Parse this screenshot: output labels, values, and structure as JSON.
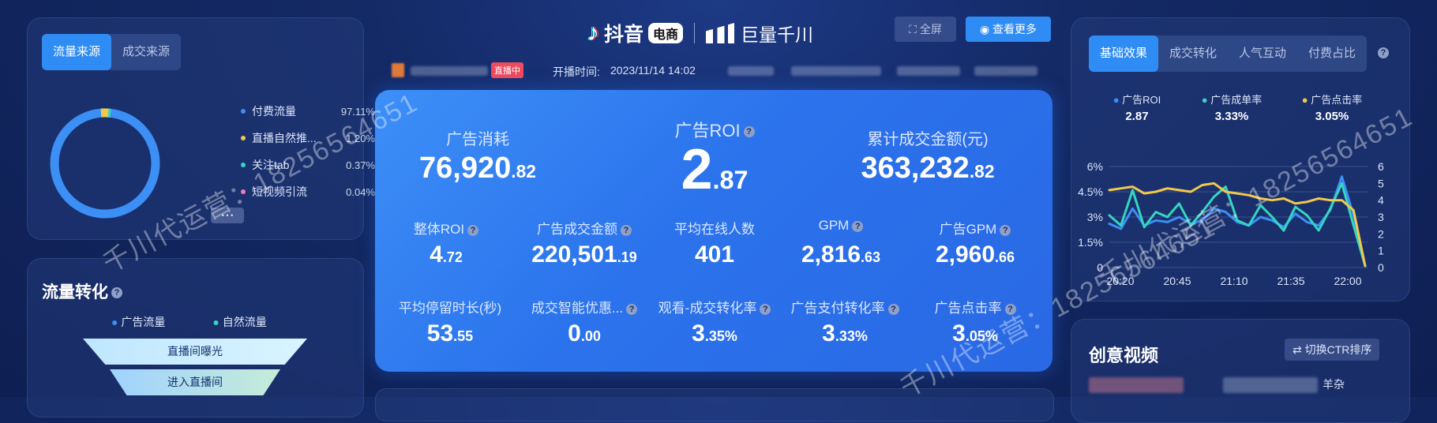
{
  "brand": {
    "douyin": "抖音",
    "ecommerce_badge": "电商",
    "qianchuan": "巨量千川"
  },
  "header": {
    "fullscreen_label": "全屏",
    "view_more_label": "查看更多",
    "live_badge": "直播中",
    "start_time_label": "开播时间:",
    "start_time": "2023/11/14 14:02"
  },
  "source": {
    "tabs": [
      "流量来源",
      "成交来源"
    ],
    "legend": [
      {
        "label": "付费流量",
        "pct": "97.11%",
        "color": "#3b8ff5"
      },
      {
        "label": "直播自然推...",
        "pct": "1.20%",
        "color": "#f2c94c"
      },
      {
        "label": "关注tab",
        "pct": "0.37%",
        "color": "#34d6c1"
      },
      {
        "label": "短视频引流",
        "pct": "0.04%",
        "color": "#f27fb0"
      }
    ],
    "more": "• • •"
  },
  "flow": {
    "title": "流量转化",
    "legend": [
      {
        "label": "广告流量",
        "color": "#3b8ff5"
      },
      {
        "label": "自然流量",
        "color": "#34d6c1"
      }
    ],
    "stages": [
      "直播间曝光",
      "进入直播间"
    ]
  },
  "metrics": {
    "top": [
      {
        "title": "广告消耗",
        "int": "76,920",
        "dec": ".82",
        "help": false
      },
      {
        "title": "广告ROI",
        "int": "2",
        "dec": ".87",
        "help": true
      },
      {
        "title": "累计成交金额(元)",
        "int": "363,232",
        "dec": ".82",
        "help": false
      }
    ],
    "row2": [
      {
        "title": "整体ROI",
        "int": "4",
        "dec": ".72"
      },
      {
        "title": "广告成交金额",
        "int": "220,501",
        "dec": ".19"
      },
      {
        "title": "平均在线人数",
        "int": "401",
        "dec": ""
      },
      {
        "title": "GPM",
        "int": "2,816",
        "dec": ".63"
      },
      {
        "title": "广告GPM",
        "int": "2,960",
        "dec": ".66"
      }
    ],
    "row3": [
      {
        "title": "平均停留时长(秒)",
        "int": "53",
        "dec": ".55"
      },
      {
        "title": "成交智能优惠...",
        "int": "0",
        "dec": ".00"
      },
      {
        "title": "观看-成交转化率",
        "int": "3",
        "dec": ".35%"
      },
      {
        "title": "广告支付转化率",
        "int": "3",
        "dec": ".33%"
      },
      {
        "title": "广告点击率",
        "int": "3",
        "dec": ".05%"
      }
    ]
  },
  "effect": {
    "tabs": [
      "基础效果",
      "成交转化",
      "人气互动",
      "付费占比"
    ],
    "legend": [
      {
        "label": "广告ROI",
        "value": "2.87",
        "color": "#3b8ff5"
      },
      {
        "label": "广告成单率",
        "value": "3.33%",
        "color": "#34d6c1"
      },
      {
        "label": "广告点击率",
        "value": "3.05%",
        "color": "#f2c94c"
      }
    ]
  },
  "chart_data": {
    "type": "line",
    "x": [
      "20:20",
      "20:45",
      "21:10",
      "21:35",
      "22:00"
    ],
    "left_axis_ticks": [
      "6%",
      "4.5%",
      "3%",
      "1.5%",
      "0"
    ],
    "right_axis_ticks": [
      "6",
      "5",
      "4",
      "3",
      "2",
      "1",
      "0"
    ],
    "ylim_left": [
      0,
      6
    ],
    "ylim_right": [
      0,
      6
    ],
    "series": [
      {
        "name": "广告ROI",
        "color": "#3b8ff5",
        "axis": "right",
        "values": [
          2.6,
          2.3,
          3.5,
          2.5,
          2.8,
          2.7,
          3.0,
          2.6,
          2.8,
          3.5,
          3.3,
          2.7,
          2.5,
          3.0,
          2.8,
          2.4,
          3.2,
          2.7,
          2.5,
          3.4,
          5.4,
          3.1,
          0.1
        ]
      },
      {
        "name": "广告成单率",
        "color": "#34d6c1",
        "axis": "left",
        "values": [
          3.1,
          2.5,
          4.6,
          2.4,
          3.3,
          3.0,
          3.8,
          2.5,
          3.3,
          4.2,
          4.8,
          2.8,
          2.5,
          3.7,
          3.0,
          2.2,
          3.6,
          3.1,
          2.2,
          3.5,
          5.0,
          2.5,
          0.1
        ]
      },
      {
        "name": "广告点击率",
        "color": "#f2c94c",
        "axis": "left",
        "values": [
          4.6,
          4.7,
          4.8,
          4.4,
          4.5,
          4.7,
          4.6,
          4.5,
          4.9,
          5.0,
          4.5,
          4.4,
          4.3,
          4.1,
          4.0,
          4.1,
          3.8,
          3.9,
          4.1,
          4.0,
          4.0,
          3.4,
          0.1
        ]
      }
    ]
  },
  "creative": {
    "title": "创意视频",
    "sort_button": "切换CTR排序",
    "snippet": "羊杂"
  },
  "watermark": "千川代运营：18256564651"
}
